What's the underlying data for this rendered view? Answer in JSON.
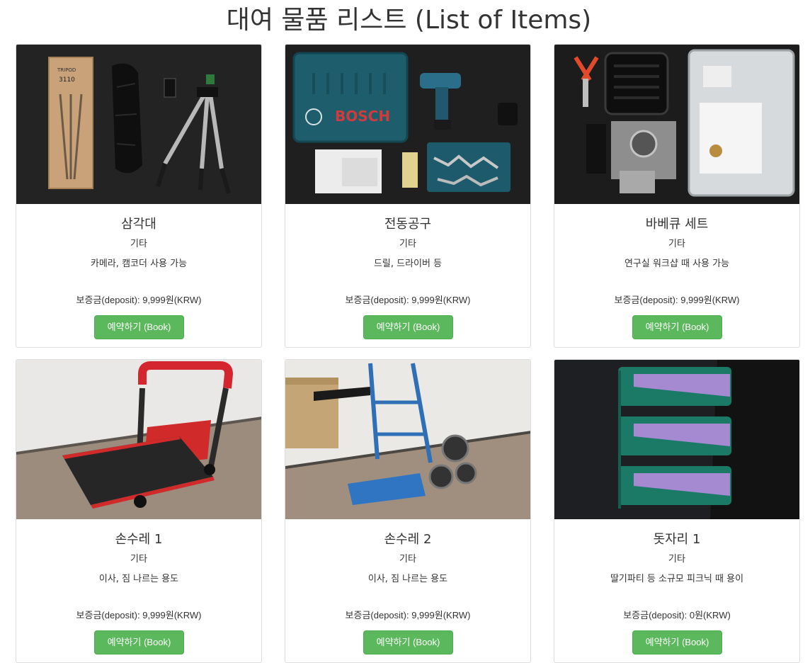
{
  "page": {
    "title": "대여 물품 리스트 (List of Items)"
  },
  "items": [
    {
      "name": "삼각대",
      "category": "기타",
      "description": "카메라, 캠코더 사용 가능",
      "deposit": "보증금(deposit): 9,999원(KRW)",
      "book_label": "예약하기 (Book)"
    },
    {
      "name": "전동공구",
      "category": "기타",
      "description": "드릴, 드라이버 등",
      "deposit": "보증금(deposit): 9,999원(KRW)",
      "book_label": "예약하기 (Book)"
    },
    {
      "name": "바베큐 세트",
      "category": "기타",
      "description": "연구실 워크샵 때 사용 가능",
      "deposit": "보증금(deposit): 9,999원(KRW)",
      "book_label": "예약하기 (Book)"
    },
    {
      "name": "손수레 1",
      "category": "기타",
      "description": "이사, 짐 나르는 용도",
      "deposit": "보증금(deposit): 9,999원(KRW)",
      "book_label": "예약하기 (Book)"
    },
    {
      "name": "손수레 2",
      "category": "기타",
      "description": "이사, 짐 나르는 용도",
      "deposit": "보증금(deposit): 9,999원(KRW)",
      "book_label": "예약하기 (Book)"
    },
    {
      "name": "돗자리 1",
      "category": "기타",
      "description": "딸기파티 등 소규모 피크닉 때 용이",
      "deposit": "보증금(deposit): 0원(KRW)",
      "book_label": "예약하기 (Book)"
    }
  ],
  "product_photo_text": {
    "bosch_logo": "BOSCH",
    "tripod_box": "3110"
  },
  "colors": {
    "button_green": "#5cb85c",
    "button_border": "#4cae4c",
    "card_border": "#dddddd"
  }
}
